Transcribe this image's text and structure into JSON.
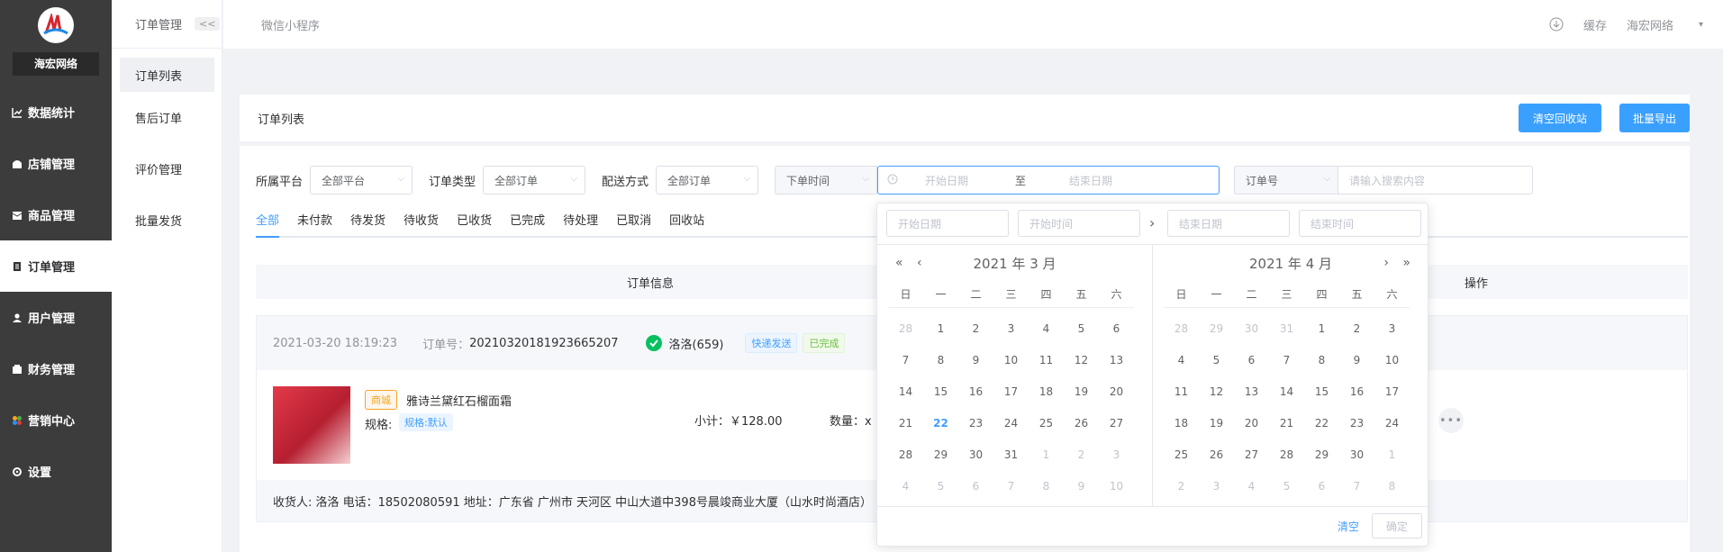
{
  "sidebar": {
    "brand": "海宏网络",
    "items": [
      {
        "label": "数据统计",
        "icon": "chart-icon"
      },
      {
        "label": "店铺管理",
        "icon": "store-icon"
      },
      {
        "label": "商品管理",
        "icon": "box-icon"
      },
      {
        "label": "订单管理",
        "icon": "clipboard-icon"
      },
      {
        "label": "用户管理",
        "icon": "user-icon"
      },
      {
        "label": "财务管理",
        "icon": "wallet-icon"
      },
      {
        "label": "营销中心",
        "icon": "marketing-icon"
      },
      {
        "label": "设置",
        "icon": "gear-icon"
      }
    ]
  },
  "subnav": {
    "title": "订单管理",
    "collapse": "<<",
    "items": [
      "订单列表",
      "售后订单",
      "评价管理",
      "批量发货"
    ]
  },
  "topbar": {
    "title": "微信小程序",
    "cache": "缓存",
    "user": "海宏网络"
  },
  "panel": {
    "title": "订单列表",
    "clear_recycle": "清空回收站",
    "batch_export": "批量导出"
  },
  "filters": {
    "platform_label": "所属平台",
    "platform_value": "全部平台",
    "type_label": "订单类型",
    "type_value": "全部订单",
    "delivery_label": "配送方式",
    "delivery_value": "全部订单",
    "time_select": "下单时间",
    "start_placeholder": "开始日期",
    "range_sep": "至",
    "end_placeholder": "结束日期",
    "order_no_select": "订单号",
    "search_placeholder": "请输入搜索内容"
  },
  "tabs": [
    "全部",
    "未付款",
    "待发货",
    "待收货",
    "已收货",
    "已完成",
    "待处理",
    "已取消",
    "回收站"
  ],
  "table": {
    "col_info": "订单信息",
    "col_action": "操作"
  },
  "order": {
    "time": "2021-03-20 18:19:23",
    "no_label": "订单号：",
    "no": "20210320181923665207",
    "buyer": "洛洛(659)",
    "tag_delivery": "快递发送",
    "tag_status": "已完成",
    "mall_tag": "商城",
    "product": "雅诗兰黛红石榴面霜",
    "spec_label": "规格:",
    "spec": "规格:默认",
    "subtotal": "小计：￥128.00",
    "qty": "数量：x",
    "footer": "收货人: 洛洛 电话：18502080591 地址：广东省 广州市 天河区 中山大道中398号晨竣商业大厦（山水时尚酒店）"
  },
  "picker": {
    "start_date": "开始日期",
    "start_time": "开始时间",
    "end_date": "结束日期",
    "end_time": "结束时间",
    "left_title": "2021 年 3 月",
    "right_title": "2021 年 4 月",
    "weekdays": [
      "日",
      "一",
      "二",
      "三",
      "四",
      "五",
      "六"
    ],
    "left_days": [
      "28",
      "1",
      "2",
      "3",
      "4",
      "5",
      "6",
      "7",
      "8",
      "9",
      "10",
      "11",
      "12",
      "13",
      "14",
      "15",
      "16",
      "17",
      "18",
      "19",
      "20",
      "21",
      "22",
      "23",
      "24",
      "25",
      "26",
      "27",
      "28",
      "29",
      "30",
      "31",
      "1",
      "2",
      "3",
      "4",
      "5",
      "6",
      "7",
      "8",
      "9",
      "10"
    ],
    "right_days": [
      "28",
      "29",
      "30",
      "31",
      "1",
      "2",
      "3",
      "4",
      "5",
      "6",
      "7",
      "8",
      "9",
      "10",
      "11",
      "12",
      "13",
      "14",
      "15",
      "16",
      "17",
      "18",
      "19",
      "20",
      "21",
      "22",
      "23",
      "24",
      "25",
      "26",
      "27",
      "28",
      "29",
      "30",
      "1",
      "2",
      "3",
      "4",
      "5",
      "6",
      "7",
      "8"
    ],
    "left_muted": [
      0,
      32,
      33,
      34,
      35,
      36,
      37,
      38,
      39,
      40,
      41
    ],
    "right_muted": [
      0,
      1,
      2,
      3,
      34,
      35,
      36,
      37,
      38,
      39,
      40,
      41
    ],
    "left_today": 22,
    "clear": "清空",
    "confirm": "确定"
  },
  "colors": {
    "primary": "#409eff",
    "sidebar": "#3c3c3c"
  }
}
